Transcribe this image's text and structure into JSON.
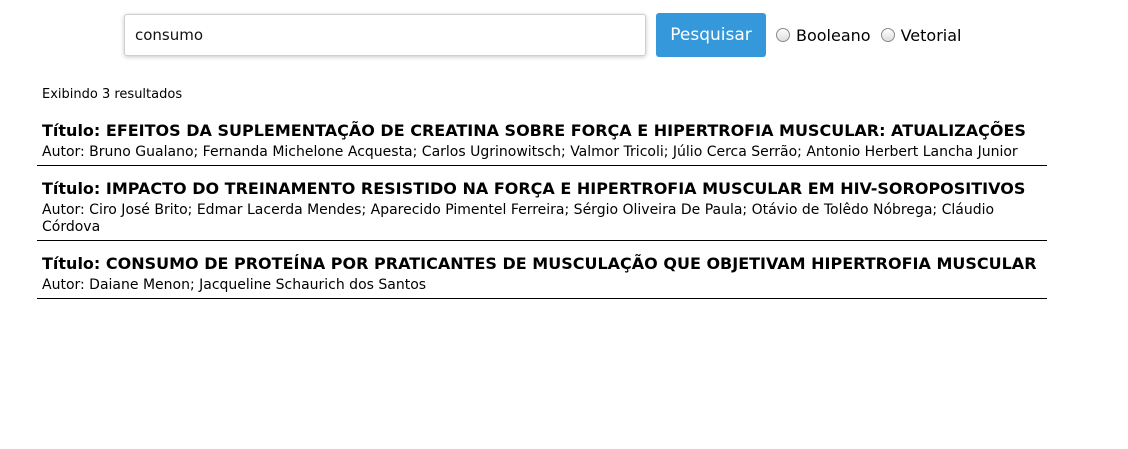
{
  "search": {
    "query": "consumo",
    "button_label": "Pesquisar",
    "options": [
      "Booleano",
      "Vetorial"
    ]
  },
  "results_summary": "Exibindo 3 resultados",
  "results": [
    {
      "title": "Título: EFEITOS DA SUPLEMENTAÇÃO DE CREATINA SOBRE FORÇA E HIPERTROFIA MUSCULAR: ATUALIZAÇÕES",
      "author": "Autor: Bruno Gualano; Fernanda Michelone Acquesta; Carlos Ugrinowitsch; Valmor Tricoli; Júlio Cerca Serrão; Antonio Herbert Lancha Junior"
    },
    {
      "title": "Título: IMPACTO DO TREINAMENTO RESISTIDO NA FORÇA E HIPERTROFIA MUSCULAR EM HIV-SOROPOSITIVOS",
      "author": "Autor: Ciro José Brito; Edmar Lacerda Mendes; Aparecido Pimentel Ferreira; Sérgio Oliveira De Paula; Otávio de Tolêdo Nóbrega; Cláudio Córdova"
    },
    {
      "title": "Título: CONSUMO DE PROTEÍNA POR PRATICANTES DE MUSCULAÇÃO QUE OBJETIVAM HIPERTROFIA MUSCULAR",
      "author": "Autor: Daiane Menon; Jacqueline Schaurich dos Santos"
    }
  ]
}
